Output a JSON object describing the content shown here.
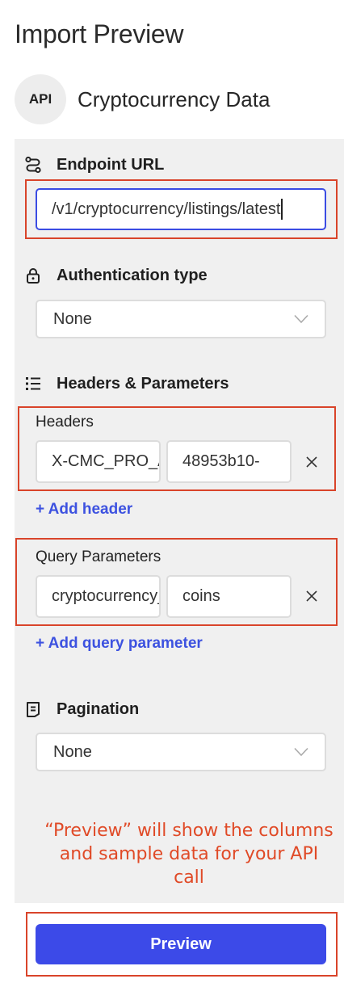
{
  "page": {
    "title": "Import Preview"
  },
  "source": {
    "badge": "API",
    "name": "Cryptocurrency Data"
  },
  "endpoint": {
    "label": "Endpoint URL",
    "value": "/v1/cryptocurrency/listings/latest"
  },
  "auth": {
    "label": "Authentication type",
    "selected": "None"
  },
  "params_section": {
    "label": "Headers & Parameters"
  },
  "headers": {
    "label": "Headers",
    "rows": [
      {
        "key": "X-CMC_PRO_API_KEY",
        "value": "48953b10-"
      }
    ],
    "add_label": "+ Add header"
  },
  "query": {
    "label": "Query Parameters",
    "rows": [
      {
        "key": "cryptocurrency_type",
        "value": "coins"
      }
    ],
    "add_label": "+ Add query parameter"
  },
  "pagination": {
    "label": "Pagination",
    "selected": "None"
  },
  "annotation": {
    "text": "“Preview” will show the columns and sample data for your API call"
  },
  "actions": {
    "preview_label": "Preview"
  },
  "icons": {
    "endpoint": "route-icon",
    "auth": "lock-icon",
    "params": "list-icon",
    "pagination": "page-icon",
    "select": "chevron-down-icon",
    "remove": "close-icon"
  },
  "colors": {
    "accent": "#3c4ae8",
    "link": "#3d52e0",
    "annotation": "#e04a27",
    "highlight": "#d9442a",
    "panel": "#f0f0f0"
  }
}
